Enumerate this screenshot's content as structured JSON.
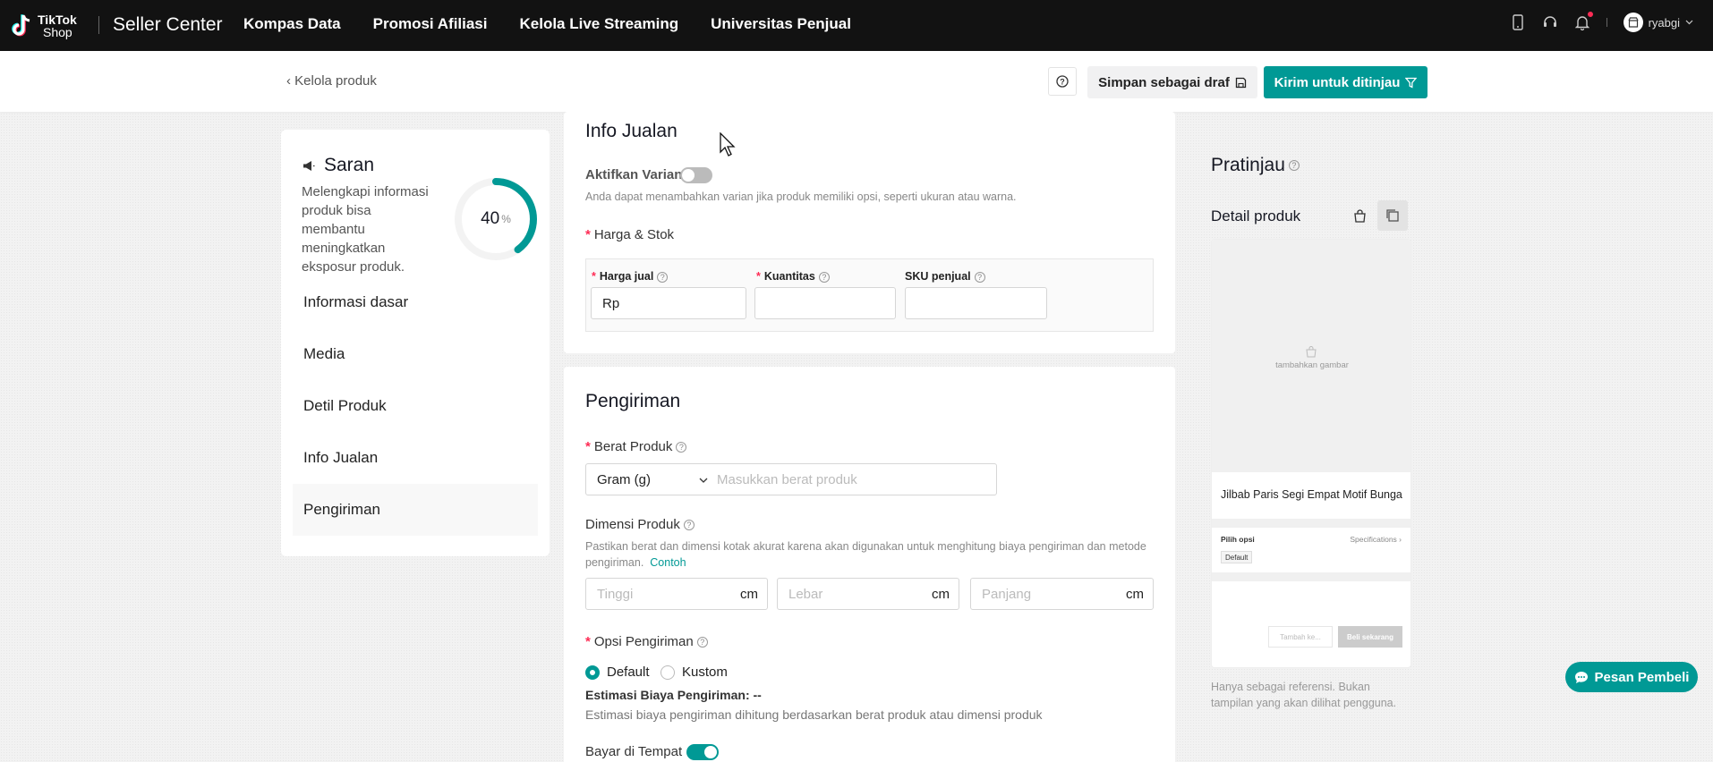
{
  "topbar": {
    "logo_name": "TikTok",
    "logo_sub": "Shop",
    "brand": "Seller Center",
    "nav": [
      "Kompas Data",
      "Promosi Afiliasi",
      "Kelola Live Streaming",
      "Universitas Penjual"
    ],
    "username": "ryabgi",
    "icons": [
      "phone-icon",
      "headset-icon",
      "bell-icon",
      "store-avatar-icon",
      "chevron-down-icon"
    ]
  },
  "subbar": {
    "back_label": "Kelola produk",
    "draft_label": "Simpan sebagai draf",
    "submit_label": "Kirim untuk ditinjau"
  },
  "suggestion": {
    "title": "Saran",
    "description": "Melengkapi informasi produk bisa membantu meningkatkan eksposur produk.",
    "progress_value": "40",
    "progress_unit": "%",
    "progress_fraction": 0.4,
    "nav_items": [
      "Informasi dasar",
      "Media",
      "Detil Produk",
      "Info Jualan",
      "Pengiriman"
    ],
    "active_item": "Pengiriman"
  },
  "sales_info": {
    "title": "Info Jualan",
    "variant_label": "Aktifkan Varian",
    "variant_enabled": false,
    "variant_hint": "Anda dapat menambahkan varian jika produk memiliki opsi, seperti ukuran atau warna.",
    "price_stock_label": "Harga & Stok",
    "columns": [
      "Harga jual",
      "Kuantitas",
      "SKU penjual"
    ],
    "price_prefix": "Rp"
  },
  "shipping": {
    "title": "Pengiriman",
    "weight_label": "Berat Produk",
    "weight_unit": "Gram (g)",
    "weight_placeholder": "Masukkan berat produk",
    "dimension_label": "Dimensi Produk",
    "dimension_hint": "Pastikan berat dan dimensi kotak akurat karena akan digunakan untuk menghitung biaya pengiriman dan metode pengiriman.",
    "dimension_link": "Contoh",
    "dimension_fields": [
      {
        "placeholder": "Tinggi",
        "unit": "cm"
      },
      {
        "placeholder": "Lebar",
        "unit": "cm"
      },
      {
        "placeholder": "Panjang",
        "unit": "cm"
      }
    ],
    "option_label": "Opsi Pengiriman",
    "options": [
      "Default",
      "Kustom"
    ],
    "selected_option": "Default",
    "estimate_label": "Estimasi Biaya Pengiriman: --",
    "estimate_hint": "Estimasi biaya pengiriman dihitung berdasarkan berat produk atau dimensi produk",
    "cod_label": "Bayar di Tempat",
    "cod_enabled": true
  },
  "preview": {
    "title": "Pratinjau",
    "subtitle": "Detail produk",
    "image_placeholder": "tambahkan gambar",
    "product_name": "Jilbab Paris Segi Empat Motif Bunga",
    "options_label": "Pilih opsi",
    "specs_label": "Specifications ›",
    "chip": "Default",
    "cart_label": "Tambah ke...",
    "buy_label": "Beli sekarang",
    "note": "Hanya sebagai referensi. Bukan tampilan yang akan dilihat pengguna."
  },
  "chat": {
    "label": "Pesan Pembeli"
  },
  "colors": {
    "accent": "#009995",
    "required": "#fe2c55",
    "topbar": "#121212"
  }
}
